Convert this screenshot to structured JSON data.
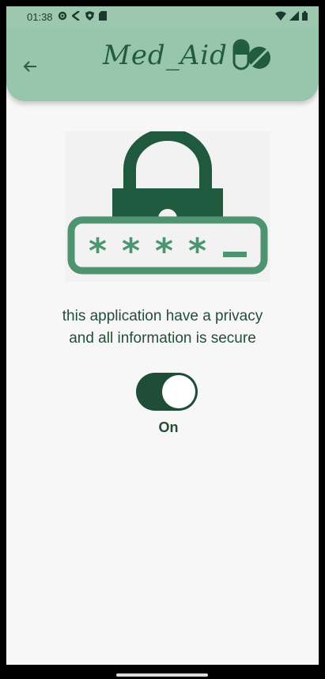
{
  "status": {
    "time": "01:38"
  },
  "app": {
    "logo_text": "Med_Aid",
    "brand_color": "#98c6ad",
    "accent": "#1f4d37"
  },
  "content": {
    "message_line1": "this application have a privacy",
    "message_line2": "and all information is secure",
    "toggle_state_label": "On",
    "toggle_on": true
  },
  "icons": [
    "settings-icon",
    "back-arrow-icon",
    "lock-icon",
    "password-icon",
    "capsule-icon",
    "wifi-icon",
    "signal-icon",
    "battery-icon"
  ]
}
